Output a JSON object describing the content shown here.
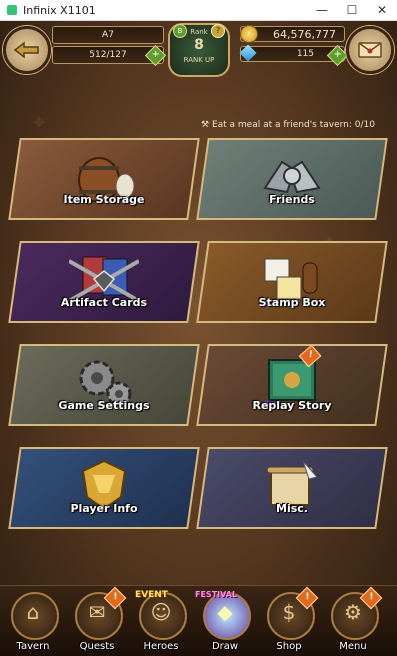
{
  "window": {
    "title": "Infinix X1101",
    "minimize": "—",
    "maximize": "☐",
    "close": "✕"
  },
  "hud": {
    "player_name": "A7",
    "stamina": "512/127",
    "rank_label": "Rank",
    "rank_value": "8",
    "rank_sub": "RANK UP",
    "gold": "64,576,777",
    "gems": "115",
    "b_badge": "B",
    "q_badge": "?"
  },
  "quest_note": "Eat a meal at a friend's tavern: 0/10",
  "tiles": [
    {
      "label": "Item Storage"
    },
    {
      "label": "Friends"
    },
    {
      "label": "Artifact Cards"
    },
    {
      "label": "Stamp Box"
    },
    {
      "label": "Game Settings"
    },
    {
      "label": "Replay Story"
    },
    {
      "label": "Player Info"
    },
    {
      "label": "Misc."
    }
  ],
  "nav": [
    {
      "label": "Tavern"
    },
    {
      "label": "Quests"
    },
    {
      "label": "Heroes",
      "tag": "EVENT"
    },
    {
      "label": "Draw",
      "tag": "FESTIVAL"
    },
    {
      "label": "Shop"
    },
    {
      "label": "Menu"
    }
  ],
  "colors": {
    "frame": "#d6b97f",
    "text": "#ffffff",
    "alert": "#e26a1e"
  }
}
